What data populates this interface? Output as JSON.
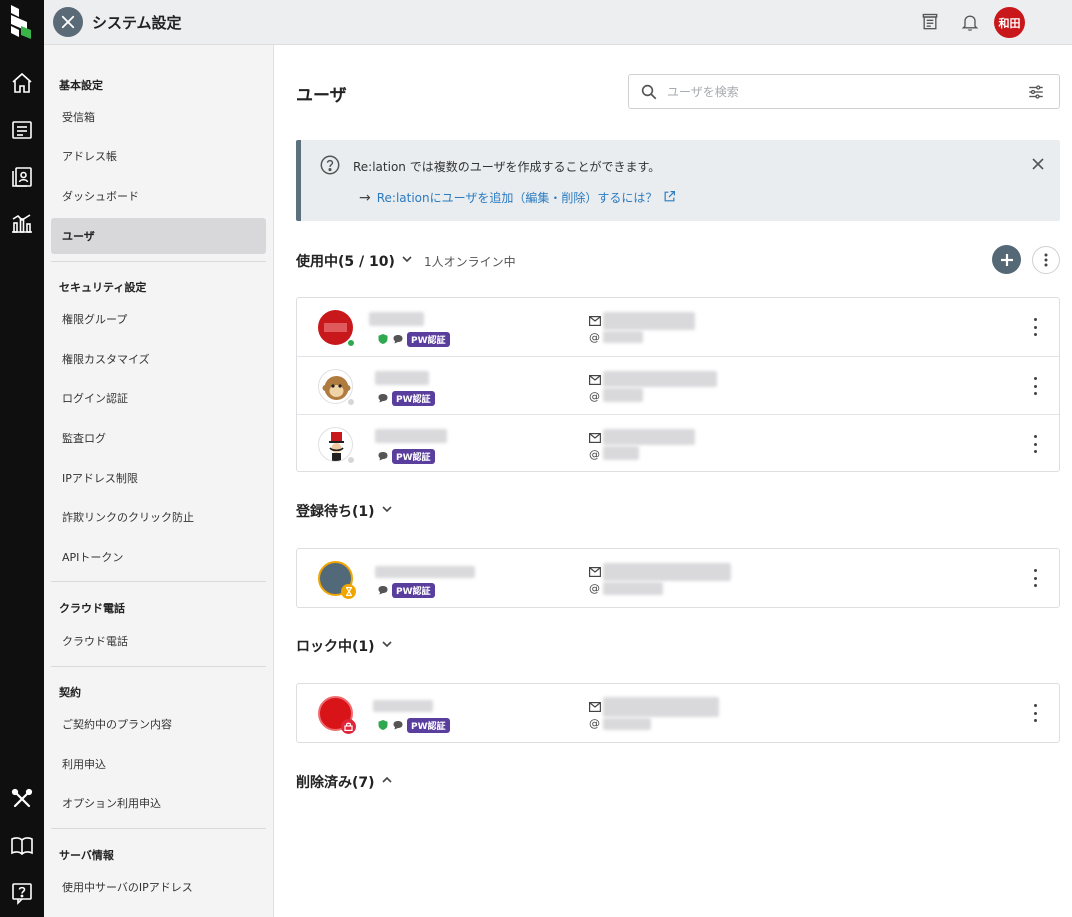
{
  "header": {
    "app_title": "システム設定",
    "user_initials": "和田"
  },
  "sidebar": {
    "sections": [
      {
        "title": "基本設定",
        "items": [
          "受信箱",
          "アドレス帳",
          "ダッシュボード",
          "ユーザ"
        ]
      },
      {
        "title": "セキュリティ設定",
        "items": [
          "権限グループ",
          "権限カスタマイズ",
          "ログイン認証",
          "監査ログ",
          "IPアドレス制限",
          "詐欺リンクのクリック防止",
          "APIトークン"
        ]
      },
      {
        "title": "クラウド電話",
        "items": [
          "クラウド電話"
        ]
      },
      {
        "title": "契約",
        "items": [
          "ご契約中のプラン内容",
          "利用申込",
          "オプション利用申込"
        ]
      },
      {
        "title": "サーバ情報",
        "items": [
          "使用中サーバのIPアドレス"
        ]
      }
    ],
    "active_item": "ユーザ"
  },
  "main": {
    "title": "ユーザ",
    "search": {
      "placeholder": "ユーザを検索",
      "value": ""
    },
    "info": {
      "text": "Re:lation では複数のユーザを作成することができます。",
      "link": "Re:lationにユーザを追加（編集・削除）するには？"
    },
    "groups": {
      "active": {
        "label": "使用中(5 / 10)",
        "online": "1人オンライン中"
      },
      "pending": {
        "label": "登録待ち(1)"
      },
      "locked": {
        "label": "ロック中(1)"
      },
      "deleted": {
        "label": "削除済み(7)"
      }
    },
    "badge_label": "PW認証",
    "contact_at": "@"
  },
  "colors": {
    "accent": "#546875",
    "link": "#2b7bc0",
    "pw_badge": "#5a3e9e",
    "online": "#2fa84f",
    "avatar_red": "#c9181b"
  }
}
